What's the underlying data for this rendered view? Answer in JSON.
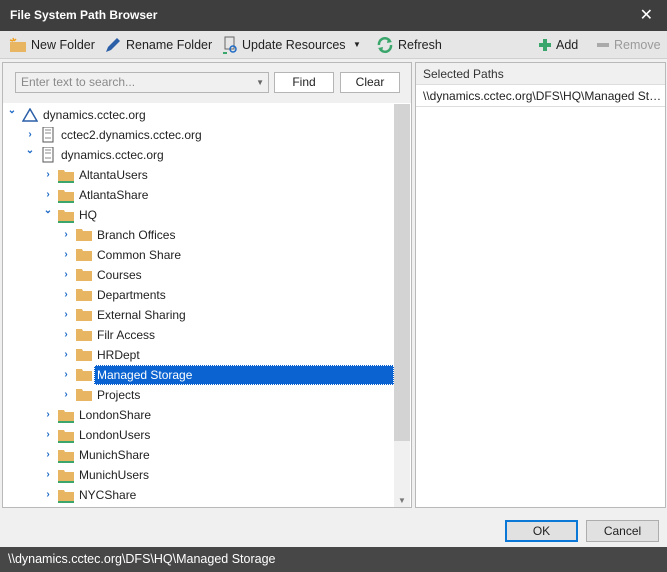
{
  "window": {
    "title": "File System Path Browser",
    "close": "✕"
  },
  "toolbar": {
    "new_folder": "New Folder",
    "rename_folder": "Rename Folder",
    "update_resources": "Update Resources",
    "refresh": "Refresh",
    "add": "Add",
    "remove": "Remove"
  },
  "search": {
    "placeholder": "Enter text to search...",
    "find": "Find",
    "clear": "Clear"
  },
  "tree": [
    {
      "label": "dynamics.cctec.org",
      "level": 0,
      "icon": "domain",
      "expanded": true
    },
    {
      "label": "cctec2.dynamics.cctec.org",
      "level": 1,
      "icon": "server",
      "expanded": false
    },
    {
      "label": "dynamics.cctec.org",
      "level": 1,
      "icon": "server",
      "expanded": true
    },
    {
      "label": "AltantaUsers",
      "level": 2,
      "icon": "share",
      "expanded": false
    },
    {
      "label": "AtlantaShare",
      "level": 2,
      "icon": "share",
      "expanded": false
    },
    {
      "label": "HQ",
      "level": 2,
      "icon": "share",
      "expanded": true
    },
    {
      "label": "Branch Offices",
      "level": 3,
      "icon": "folder",
      "expanded": false
    },
    {
      "label": "Common Share",
      "level": 3,
      "icon": "folder",
      "expanded": false
    },
    {
      "label": "Courses",
      "level": 3,
      "icon": "folder",
      "expanded": false
    },
    {
      "label": "Departments",
      "level": 3,
      "icon": "folder",
      "expanded": false
    },
    {
      "label": "External Sharing",
      "level": 3,
      "icon": "folder",
      "expanded": false
    },
    {
      "label": "Filr Access",
      "level": 3,
      "icon": "folder",
      "expanded": false
    },
    {
      "label": "HRDept",
      "level": 3,
      "icon": "folder",
      "expanded": false
    },
    {
      "label": "Managed Storage",
      "level": 3,
      "icon": "folder",
      "expanded": false,
      "selected": true
    },
    {
      "label": "Projects",
      "level": 3,
      "icon": "folder",
      "expanded": false
    },
    {
      "label": "LondonShare",
      "level": 2,
      "icon": "share",
      "expanded": false
    },
    {
      "label": "LondonUsers",
      "level": 2,
      "icon": "share",
      "expanded": false
    },
    {
      "label": "MunichShare",
      "level": 2,
      "icon": "share",
      "expanded": false
    },
    {
      "label": "MunichUsers",
      "level": 2,
      "icon": "share",
      "expanded": false
    },
    {
      "label": "NYCShare",
      "level": 2,
      "icon": "share",
      "expanded": false
    }
  ],
  "selected_paths": {
    "header": "Selected Paths",
    "items": [
      "\\\\dynamics.cctec.org\\DFS\\HQ\\Managed Stor..."
    ]
  },
  "footer": {
    "ok": "OK",
    "cancel": "Cancel"
  },
  "status": "\\\\dynamics.cctec.org\\DFS\\HQ\\Managed Storage",
  "colors": {
    "accent": "#0b63d1",
    "folder": "#e8b563",
    "share_line": "#3aa66b"
  }
}
